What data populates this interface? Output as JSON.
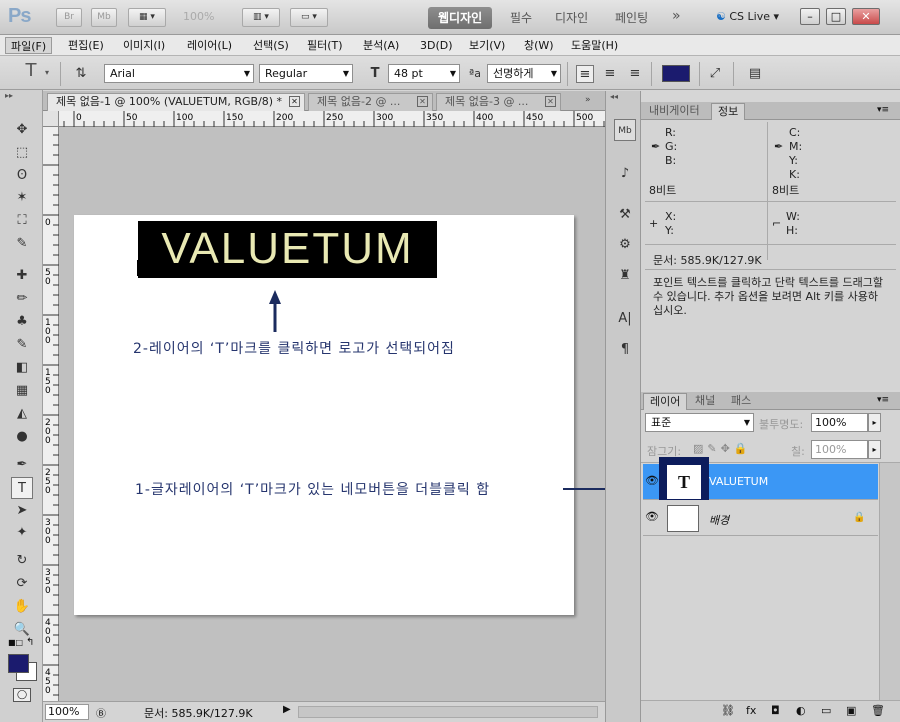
{
  "app": {
    "logo": "Ps",
    "zoom_display": "100%",
    "workspace_tabs": [
      "웹디자인",
      "필수",
      "디자인",
      "페인팅"
    ],
    "cs_live": "CS Live",
    "overflow_chevron": "»",
    "top_buttons": [
      "Br",
      "Mb"
    ],
    "window_buttons": [
      "–",
      "□",
      "✕"
    ]
  },
  "menubar": {
    "items": [
      "파일(F)",
      "편집(E)",
      "이미지(I)",
      "레이어(L)",
      "선택(S)",
      "필터(T)",
      "분석(A)",
      "3D(D)",
      "보기(V)",
      "창(W)",
      "도움말(H)"
    ]
  },
  "options": {
    "font_family": "Arial",
    "font_style": "Regular",
    "font_size": "48 pt",
    "antialias_icon": "ªa",
    "antialias": "선명하게",
    "text_color": "#1b1b6e"
  },
  "documents": {
    "tabs": [
      "제목 없음-1 @ 100% (VALUETUM, RGB/8) *",
      "제목 없음-2 @ ...",
      "제목 없음-3 @ ..."
    ],
    "ruler_labels": [
      "0",
      "50",
      "100",
      "150",
      "200",
      "250",
      "300",
      "350",
      "400",
      "450",
      "500"
    ],
    "ruler_v_labels": [
      "0",
      "5",
      "1",
      "5",
      "2",
      "0",
      "2",
      "5",
      "3",
      "0",
      "3",
      "5",
      "4",
      "0",
      "4",
      "5",
      "5"
    ]
  },
  "canvas": {
    "logo_text": "VALUETUM",
    "annotation_2": "2-레이어의 ‘T’마크를 클릭하면 로고가 선택되어짐",
    "annotation_1": "1-글자레이어의 ‘T’마크가 있는 네모버튼을 더블클릭 함",
    "annotation_color": "#26356e"
  },
  "status": {
    "zoom": "100%",
    "doc_info": "문서: 585.9K/127.9K"
  },
  "info_panel": {
    "tabs": [
      "내비게이터",
      "정보"
    ],
    "rgb_labels": [
      "R:",
      "G:",
      "B:"
    ],
    "cmyk_labels": [
      "C:",
      "M:",
      "Y:",
      "K:"
    ],
    "bit_left": "8비트",
    "bit_right": "8비트",
    "xy_labels": [
      "X:",
      "Y:"
    ],
    "wh_labels": [
      "W:",
      "H:"
    ],
    "doc_info": "문서: 585.9K/127.9K",
    "help_text": "포인트 텍스트를 클릭하고 단락 텍스트를 드래그할 수 있습니다. 추가 옵션을 보려면 Alt 키를 사용하십시오."
  },
  "layers_panel": {
    "tabs": [
      "레이어",
      "채널",
      "패스"
    ],
    "blend_mode": "표준",
    "opacity_label": "불투명도:",
    "opacity_value": "100%",
    "lock_label": "잠그기:",
    "fill_label": "칠:",
    "fill_value": "100%",
    "layers": [
      {
        "name": "VALUETUM",
        "thumb": "T",
        "selected": true
      },
      {
        "name": "배경",
        "thumb": "",
        "selected": false
      }
    ],
    "footer_icons": [
      "link-icon",
      "fx-icon",
      "mask-icon",
      "adjustment-icon",
      "group-icon",
      "new-layer-icon",
      "trash-icon"
    ],
    "footer_glyphs": [
      "⛓",
      "fx",
      "◘",
      "◐",
      "▭",
      "▣",
      "🗑"
    ]
  },
  "toolbar": {
    "tools": [
      "move-tool",
      "marquee-tool",
      "lasso-tool",
      "magic-wand-tool",
      "crop-tool",
      "eyedropper-tool",
      "healing-brush-tool",
      "brush-tool",
      "clone-stamp-tool",
      "history-brush-tool",
      "eraser-tool",
      "gradient-tool",
      "blur-tool",
      "dodge-tool",
      "pen-tool",
      "type-tool",
      "path-selection-tool",
      "shape-tool",
      "3d-rotate-tool",
      "3d-orbit-tool",
      "hand-tool",
      "zoom-tool"
    ],
    "glyphs": [
      "✥",
      "⬚",
      "ʘ",
      "✶",
      "⛶",
      "✎",
      "✚",
      "✏",
      "♣",
      "✎",
      "◧",
      "▦",
      "◭",
      "●",
      "✒",
      "T",
      "➤",
      "✦",
      "↻",
      "⟳",
      "✋",
      "🔍"
    ],
    "foreground": "#1b1b6e",
    "background": "#ffffff"
  },
  "panel_strip": {
    "glyphs": [
      "Mb",
      "♪",
      "⚒",
      "⚙",
      "♜",
      "A|",
      "¶"
    ],
    "names": [
      "mini-bridge-icon",
      "history-icon",
      "brush-presets-icon",
      "clone-source-icon",
      "tool-presets-icon",
      "character-icon",
      "paragraph-icon"
    ]
  }
}
